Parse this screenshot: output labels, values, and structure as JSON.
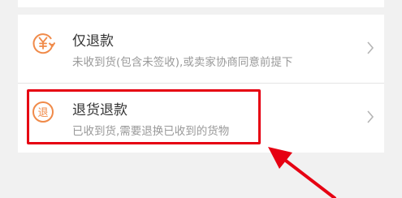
{
  "refund_options": [
    {
      "title": "仅退款",
      "description": "未收到货(包含未签收),或卖家协商同意前提下",
      "icon": "yen-refund-icon"
    },
    {
      "title": "退货退款",
      "description": "已收到货,需要退换已收到的货物",
      "icon": "return-badge-icon",
      "icon_char": "退"
    }
  ],
  "colors": {
    "accent": "#f08a49",
    "annotation": "#e60012",
    "background": "#f1f1f1",
    "card": "#ffffff"
  }
}
